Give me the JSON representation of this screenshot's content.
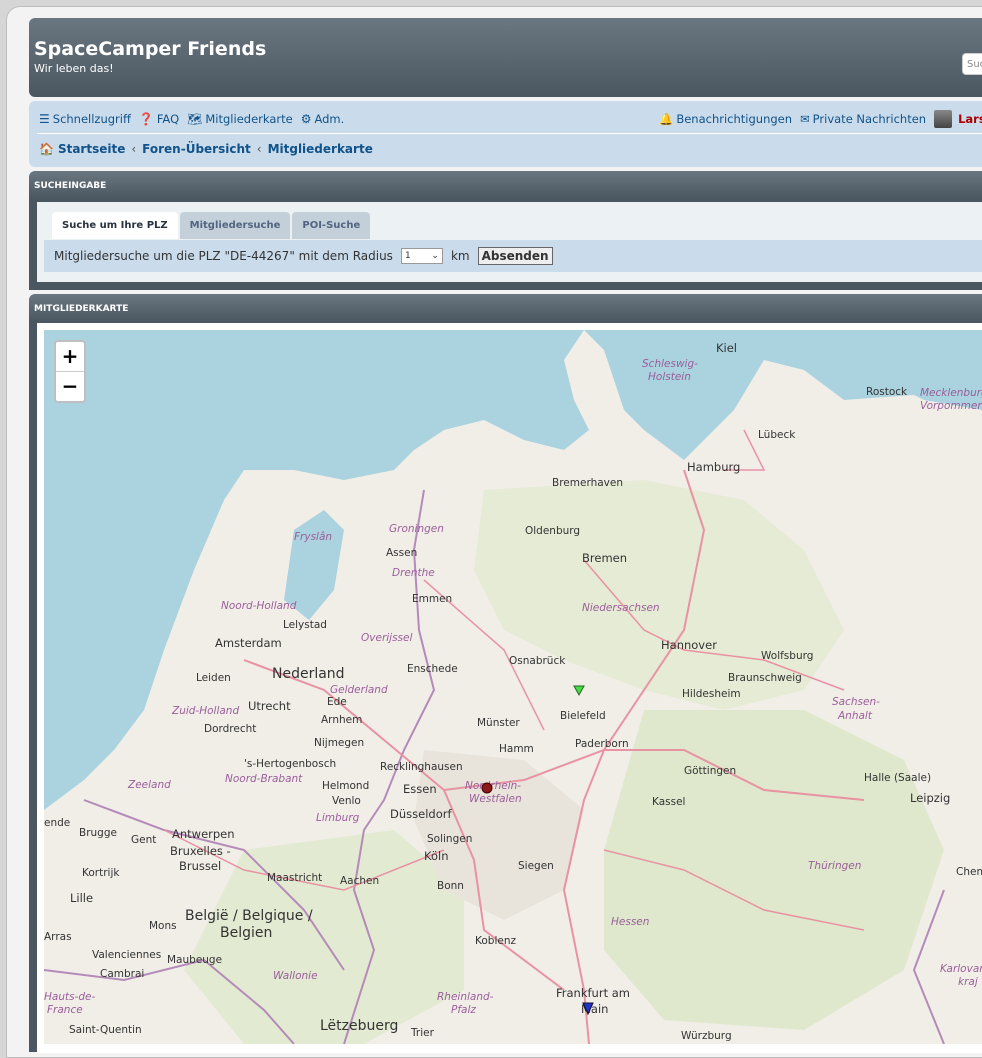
{
  "header": {
    "title": "SpaceCamper Friends",
    "subtitle": "Wir leben das!",
    "search_placeholder": "Such"
  },
  "nav": {
    "left": [
      {
        "icon": "menu-icon",
        "label": "Schnellzugriff"
      },
      {
        "icon": "help-icon",
        "label": "FAQ"
      },
      {
        "icon": "map-icon",
        "label": "Mitgliederkarte"
      },
      {
        "icon": "gears-icon",
        "label": "Adm."
      }
    ],
    "notifications": "Benachrichtigungen",
    "messages": "Private Nachrichten",
    "username": "Lars W"
  },
  "breadcrumb": [
    "Startseite",
    "Foren-Übersicht",
    "Mitgliederkarte"
  ],
  "search_panel": {
    "title": "SUCHEINGABE",
    "tabs": [
      "Suche um Ihre PLZ",
      "Mitgliedersuche",
      "POI-Suche"
    ],
    "text": "Mitgliedersuche um die PLZ \"DE-44267\" mit dem Radius",
    "radius": "1",
    "unit": "km",
    "submit": "Absenden"
  },
  "map_panel": {
    "title": "MITGLIEDERKARTE",
    "zoom_in": "+",
    "zoom_out": "−",
    "labels": {
      "kiel": "Kiel",
      "schleswig": "Schleswig-",
      "holstein": "Holstein",
      "rostock": "Rostock",
      "mecklenburg": "Mecklenburg",
      "vorpommern": "Vorpommern",
      "luebeck": "Lübeck",
      "hamburg": "Hamburg",
      "bremerhaven": "Bremerhaven",
      "oldenburg": "Oldenburg",
      "bremen": "Bremen",
      "groningen": "Groningen",
      "fryslan": "Fryslân",
      "assen": "Assen",
      "drenthe": "Drenthe",
      "emmen": "Emmen",
      "niedersachsen": "Niedersachsen",
      "noord_holland": "Noord-Holland",
      "lelystad": "Lelystad",
      "overijssel": "Overijssel",
      "amsterdam": "Amsterdam",
      "hannover": "Hannover",
      "wolfsburg": "Wolfsburg",
      "nederland": "Nederland",
      "enschede": "Enschede",
      "osnabrueck": "Osnabrück",
      "leiden": "Leiden",
      "gelderland": "Gelderland",
      "braunschweig": "Braunschweig",
      "hildesheim": "Hildesheim",
      "utrecht": "Utrecht",
      "ede": "Ede",
      "bielefeld": "Bielefeld",
      "zuid_holland": "Zuid-Holland",
      "arnhem": "Arnhem",
      "muenster": "Münster",
      "sachsen_anhalt1": "Sachsen-",
      "sachsen_anhalt2": "Anhalt",
      "dordrecht": "Dordrecht",
      "nijmegen": "Nijmegen",
      "hamm": "Hamm",
      "paderborn": "Paderborn",
      "hertogenbosch": "'s-Hertogenbosch",
      "recklinghausen": "Recklinghausen",
      "goettingen": "Göttingen",
      "noord_brabant": "Noord-Brabant",
      "halle": "Halle (Saale)",
      "zeeland": "Zeeland",
      "helmond": "Helmond",
      "essen": "Essen",
      "nrw1": "Nordrhein-",
      "nrw2": "Westfalen",
      "kassel": "Kassel",
      "leipzig": "Leipzig",
      "venlo": "Venlo",
      "limburg": "Limburg",
      "duesseldorf": "Düsseldorf",
      "gent_": "ende",
      "antwerpen": "Antwerpen",
      "brugge": "Brugge",
      "gent": "Gent",
      "solingen": "Solingen",
      "bruxelles": "Bruxelles -",
      "brussel": "Brussel",
      "koeln": "Köln",
      "siegen": "Siegen",
      "thueringen": "Thüringen",
      "chem": "Chem",
      "kortrijk": "Kortrijk",
      "maastricht": "Maastricht",
      "aachen": "Aachen",
      "bonn": "Bonn",
      "lille": "Lille",
      "belgie": "België / Belgique /",
      "belgien": "Belgien",
      "mons": "Mons",
      "hessen": "Hessen",
      "koblenz": "Koblenz",
      "arras": "Arras",
      "valenciennes": "Valenciennes",
      "maubeuge": "Maubeuge",
      "karlovar": "Karlovar",
      "kraj": "kraj",
      "cambrai": "Cambrai",
      "wallonie": "Wallonie",
      "frankfurt": "Frankfurt am",
      "main": "Main",
      "hauts": "Hauts-de-",
      "france": "France",
      "rheinland1": "Rheinland-",
      "rheinland2": "Pfalz",
      "saint_quentin": "Saint-Quentin",
      "letzebuerg": "Lëtzebuerg",
      "trier": "Trier",
      "wuerzburg": "Würzburg"
    }
  }
}
